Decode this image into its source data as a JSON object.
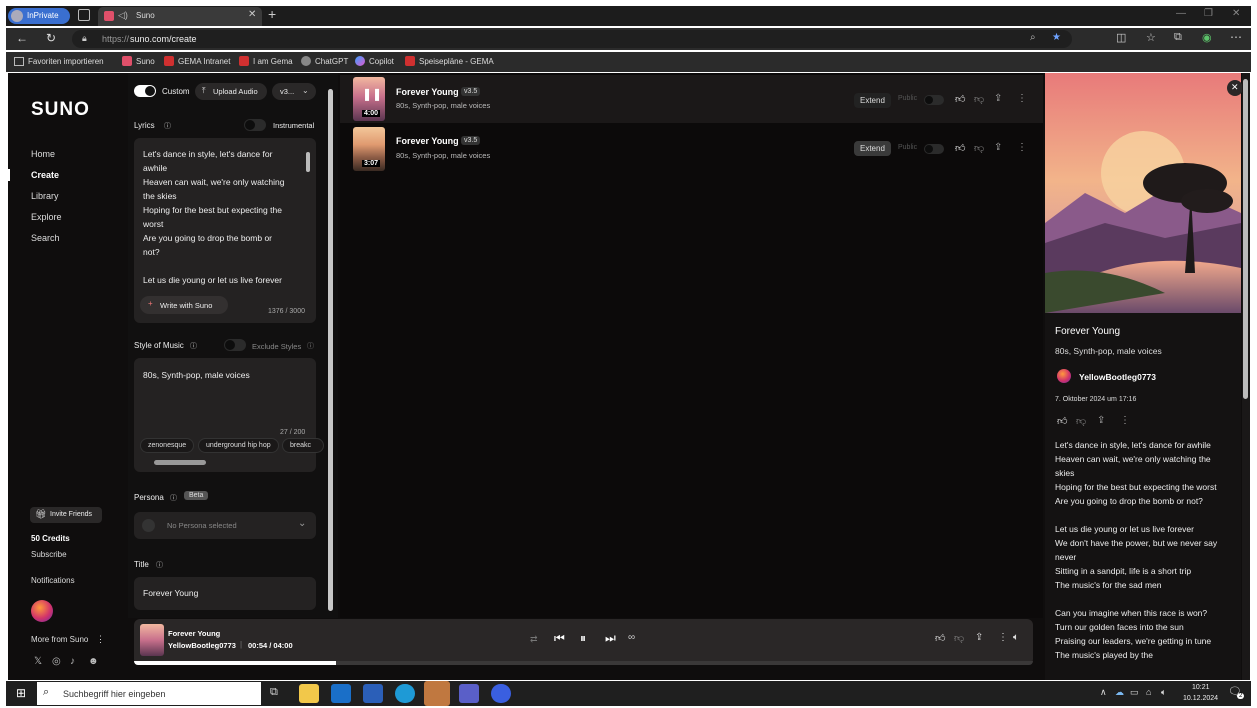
{
  "browser": {
    "private_label": "InPrivate",
    "tab_title": "Suno",
    "url_prefix": "https://",
    "url_main": "suno.com/create",
    "bookmarks": [
      "Favoriten importieren",
      "Suno",
      "GEMA Intranet",
      "I am Gema",
      "ChatGPT",
      "Copilot",
      "Speisepläne - GEMA"
    ]
  },
  "sidebar": {
    "logo": "SUNO",
    "nav": [
      "Home",
      "Create",
      "Library",
      "Explore",
      "Search"
    ],
    "invite_label": "Invite Friends",
    "credits": "50 Credits",
    "subscribe": "Subscribe",
    "notifications": "Notifications",
    "more_from": "More from Suno"
  },
  "create": {
    "custom_label": "Custom",
    "upload_label": "Upload Audio",
    "version_label": "v3...",
    "lyrics_label": "Lyrics",
    "instrumental_label": "Instrumental",
    "lyrics_lines": [
      "Let's dance in style, let's dance for",
      "awhile",
      "Heaven can wait, we're only watching",
      "the skies",
      "Hoping for the best but expecting the",
      "worst",
      "Are you going to drop the bomb or",
      "not?",
      "",
      "Let us die young or let us live forever"
    ],
    "write_with_suno": "Write with Suno",
    "lyrics_count": "1376 / 3000",
    "style_label": "Style of Music",
    "exclude_label": "Exclude Styles",
    "style_value": "80s, Synth-pop, male voices",
    "style_count": "27 / 200",
    "tags": [
      "zenonesque",
      "underground hip hop",
      "breakc"
    ],
    "persona_label": "Persona",
    "beta_label": "Beta",
    "persona_placeholder": "No Persona selected",
    "title_label": "Title",
    "title_value": "Forever Young"
  },
  "songs": [
    {
      "title": "Forever Young",
      "version": "v3.5",
      "style": "80s, Synth-pop, male voices",
      "duration": "4:00",
      "extend": "Extend",
      "public": "Public"
    },
    {
      "title": "Forever Young",
      "version": "v3.5",
      "style": "80s, Synth-pop, male voices",
      "duration": "3:07",
      "extend": "Extend",
      "public": "Public"
    }
  ],
  "player": {
    "title": "Forever Young",
    "artist": "YellowBootleg0773",
    "time": "00:54 / 04:00"
  },
  "detail": {
    "title": "Forever Young",
    "style": "80s, Synth-pop, male voices",
    "user": "YellowBootleg0773",
    "date": "7. Oktober 2024 um 17:16",
    "lyrics": [
      "Let's dance in style, let's dance for awhile",
      "Heaven can wait, we're only watching the",
      "skies",
      "Hoping for the best but expecting the worst",
      "Are you going to drop the bomb or not?",
      "",
      "Let us die young or let us live forever",
      "We don't have the power, but we never say",
      "never",
      "Sitting in a sandpit, life is a short trip",
      "The music's for the sad men",
      "",
      "Can you imagine when this race is won?",
      "Turn our golden faces into the sun",
      "Praising our leaders, we're getting in tune",
      "The music's played by the"
    ]
  },
  "taskbar": {
    "search_placeholder": "Suchbegriff hier eingeben",
    "time": "10:21",
    "date": "10.12.2024",
    "notif_count": "2"
  }
}
